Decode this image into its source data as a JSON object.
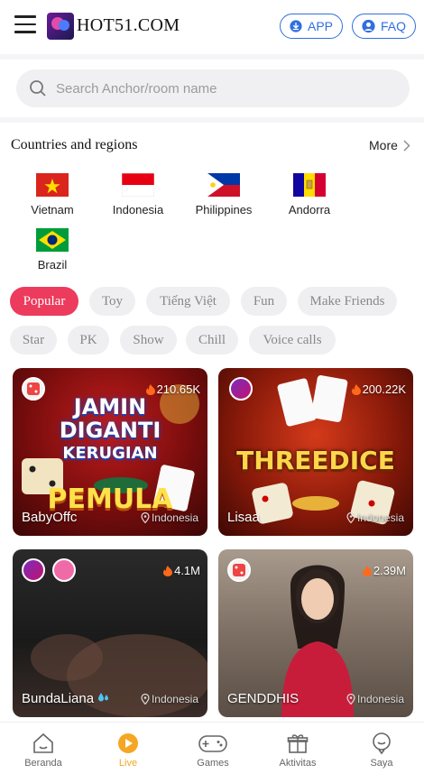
{
  "header": {
    "logo_text": "HOT51.COM",
    "app_label": "APP",
    "faq_label": "FAQ"
  },
  "search": {
    "placeholder": "Search Anchor/room name"
  },
  "regions": {
    "title": "Countries and regions",
    "more_label": "More",
    "items": [
      {
        "name": "Vietnam"
      },
      {
        "name": "Indonesia"
      },
      {
        "name": "Philippines"
      },
      {
        "name": "Andorra"
      },
      {
        "name": "Brazil"
      }
    ]
  },
  "tags": [
    "Popular",
    "Toy",
    "Tiếng Việt",
    "Fun",
    "Make Friends",
    "Star",
    "PK",
    "Show",
    "Chill",
    "Voice calls"
  ],
  "cards": [
    {
      "streamer": "BabyOffc",
      "views": "210.65K",
      "location": "Indonesia",
      "art_line1": "JAMIN",
      "art_line2": "DIGANTI",
      "art_line3": "KERUGIAN",
      "art_line4": "PEMULA"
    },
    {
      "streamer": "Lisaa",
      "views": "200.22K",
      "location": "Indonesia",
      "art_line1": "THREEDICE"
    },
    {
      "streamer": "BundaLiana",
      "views": "4.1M",
      "location": "Indonesia"
    },
    {
      "streamer": "GENDDHIS",
      "views": "2.39M",
      "location": "Indonesia"
    }
  ],
  "tabbar": {
    "items": [
      {
        "label": "Beranda"
      },
      {
        "label": "Live"
      },
      {
        "label": "Games"
      },
      {
        "label": "Aktivitas"
      },
      {
        "label": "Saya"
      }
    ],
    "active": "Live"
  },
  "colors": {
    "accent_blue": "#2f6fe0",
    "tag_active": "#ec3b5c",
    "tab_active": "#f5a623"
  }
}
